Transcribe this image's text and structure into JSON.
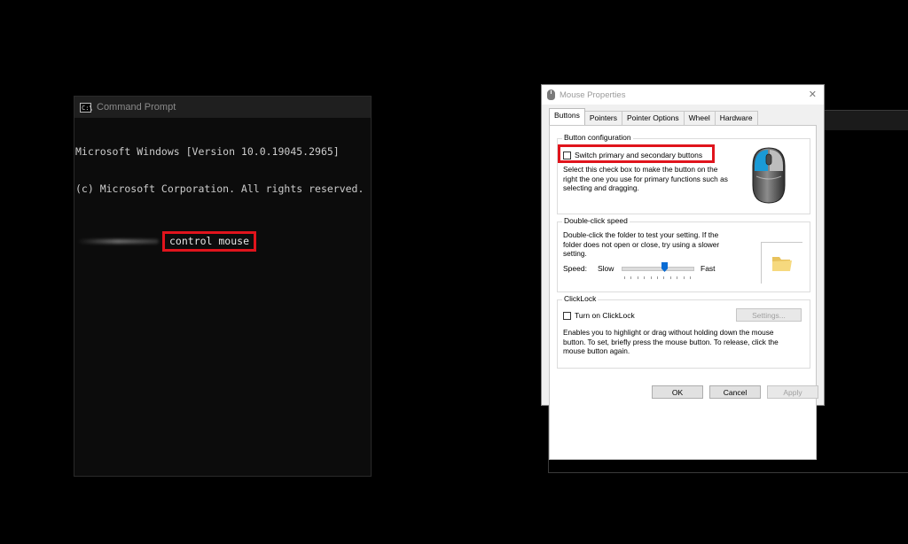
{
  "cmd": {
    "title": "Command Prompt",
    "icon": "cmd-icon",
    "icon_text": "C:\\",
    "line1": "Microsoft Windows [Version 10.0.19045.2965]",
    "line2": "(c) Microsoft Corporation. All rights reserved.",
    "command": "control mouse"
  },
  "dialog": {
    "title": "Mouse Properties",
    "close": "✕",
    "tabs": [
      "Buttons",
      "Pointers",
      "Pointer Options",
      "Wheel",
      "Hardware"
    ],
    "active_tab": "Buttons",
    "button_config": {
      "title": "Button configuration",
      "checkbox_label": "Switch primary and secondary buttons",
      "checked": false,
      "description": "Select this check box to make the button on the right the one you use for primary functions such as selecting and dragging."
    },
    "double_click": {
      "title": "Double-click speed",
      "description": "Double-click the folder to test your setting. If the folder does not open or close, try using a slower setting.",
      "speed_label": "Speed:",
      "slow_label": "Slow",
      "fast_label": "Fast",
      "speed_value": 0.6
    },
    "clicklock": {
      "title": "ClickLock",
      "checkbox_label": "Turn on ClickLock",
      "checked": false,
      "settings_button": "Settings...",
      "description": "Enables you to highlight or drag without holding down the mouse button. To set, briefly press the mouse button. To release, click the mouse button again."
    },
    "buttons": {
      "ok": "OK",
      "cancel": "Cancel",
      "apply": "Apply"
    }
  },
  "colors": {
    "highlight": "#e0141c",
    "slider_thumb": "#0a6cd4",
    "mouse_accent": "#1a9ad6"
  }
}
